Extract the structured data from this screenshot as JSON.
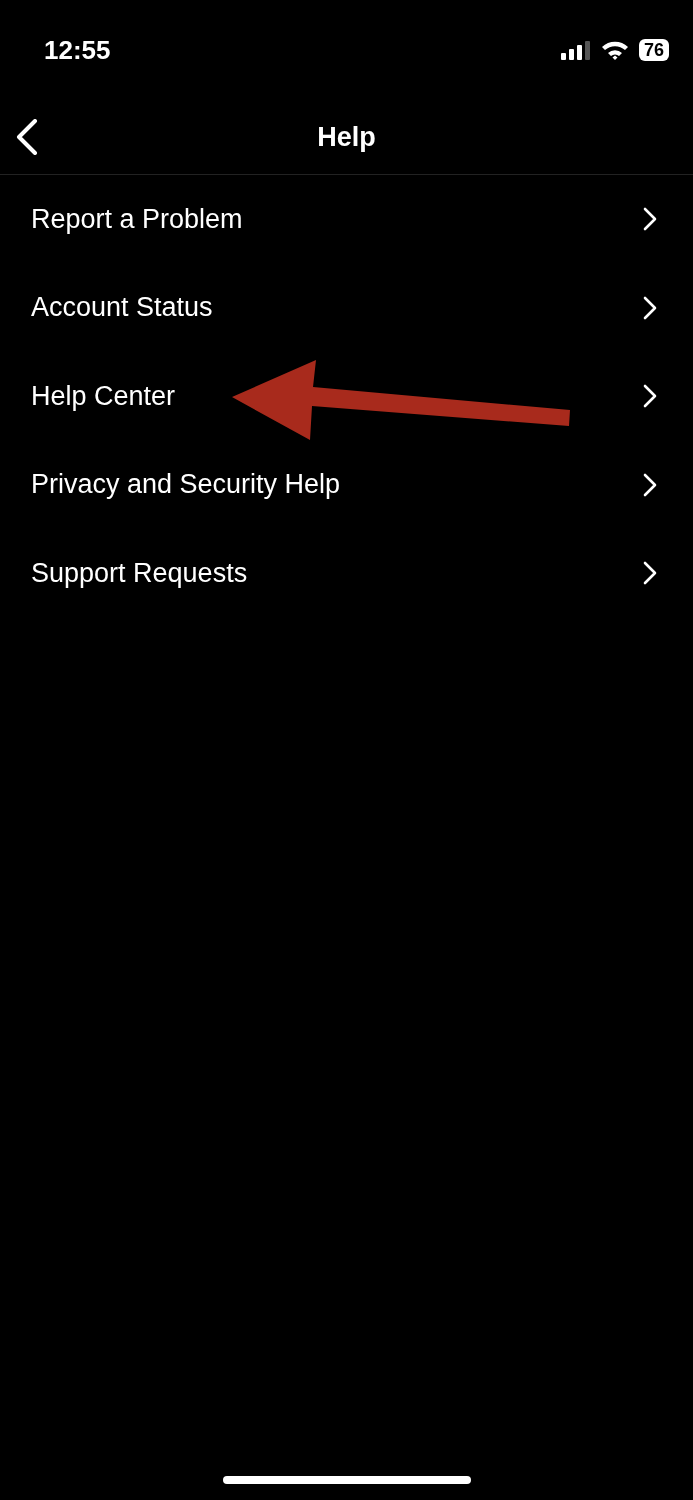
{
  "status_bar": {
    "time": "12:55",
    "battery": "76"
  },
  "nav": {
    "title": "Help"
  },
  "items": [
    {
      "label": "Report a Problem"
    },
    {
      "label": "Account Status"
    },
    {
      "label": "Help Center"
    },
    {
      "label": "Privacy and Security Help"
    },
    {
      "label": "Support Requests"
    }
  ]
}
